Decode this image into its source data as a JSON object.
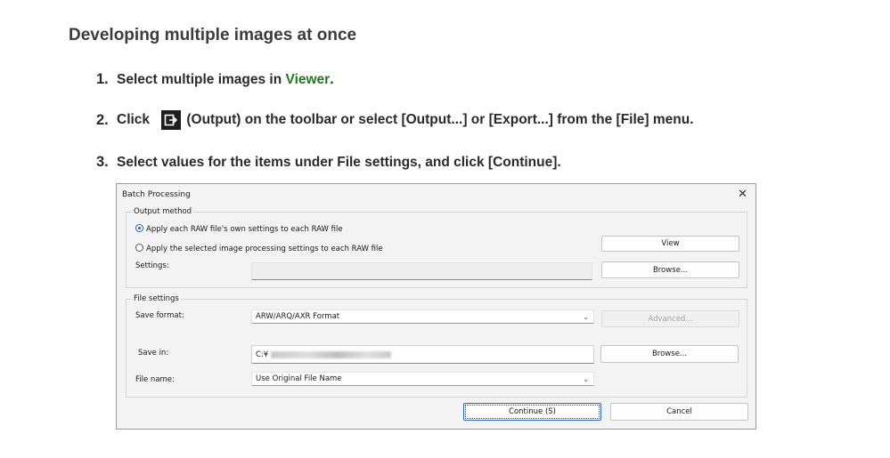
{
  "page": {
    "heading": "Developing multiple images at once",
    "steps": [
      {
        "num": "1.",
        "text_before": "Select multiple images in ",
        "link": "Viewer",
        "text_after": "."
      },
      {
        "num": "2.",
        "text_before": "Click ",
        "icon": "output-icon",
        "text_after": "(Output) on the toolbar or select [Output...] or [Export...] from the [File] menu."
      },
      {
        "num": "3.",
        "text": "Select values for the items under File settings, and click [Continue]."
      }
    ]
  },
  "dialog": {
    "title": "Batch Processing",
    "close_glyph": "✕",
    "output_method": {
      "label": "Output method",
      "options": [
        {
          "label": "Apply each RAW file's own settings to each RAW file",
          "selected": true
        },
        {
          "label": "Apply the selected image processing settings to each RAW file",
          "selected": false
        }
      ],
      "settings_label": "Settings:",
      "settings_value": "",
      "view_button": "View",
      "browse_button": "Browse..."
    },
    "file_settings": {
      "label": "File settings",
      "save_format_label": "Save format:",
      "save_format_value": "ARW/ARQ/AXR Format",
      "advanced_button": "Advanced...",
      "save_in_label": "Save in:",
      "save_in_value": "C:¥",
      "browse_button": "Browse...",
      "file_name_label": "File name:",
      "file_name_value": "Use Original File Name"
    },
    "continue_button": "Continue (S)",
    "cancel_button": "Cancel"
  },
  "colors": {
    "link": "#1f7a1f",
    "accent": "#1a5fb4"
  }
}
